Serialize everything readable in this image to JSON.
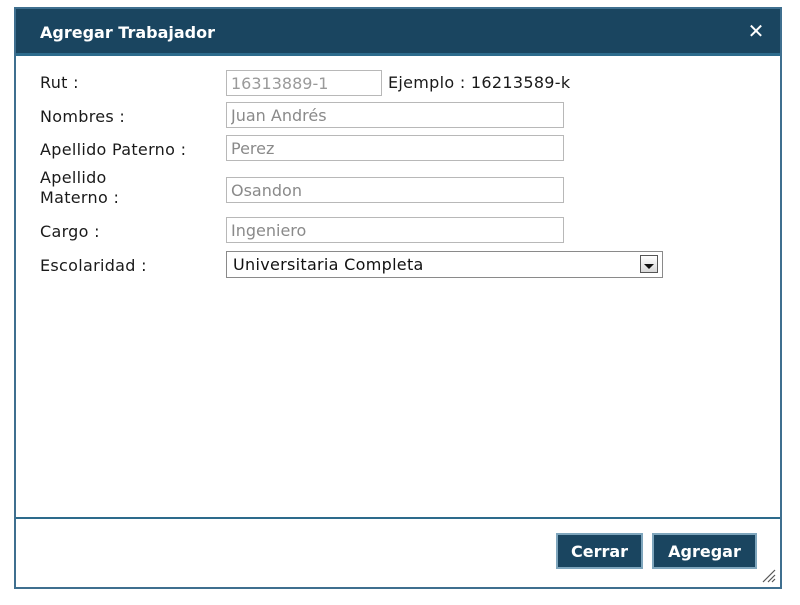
{
  "dialog": {
    "title": "Agregar Trabajador",
    "close_icon": "close-icon"
  },
  "form": {
    "rut": {
      "label": "Rut :",
      "value": "16313889-1",
      "example": "Ejemplo : 16213589-k"
    },
    "nombres": {
      "label": "Nombres :",
      "value": "Juan Andrés"
    },
    "apellido_paterno": {
      "label": "Apellido Paterno :",
      "value": "Perez"
    },
    "apellido_materno": {
      "label_line1": "Apellido",
      "label_line2": "Materno :",
      "value": "Osandon"
    },
    "cargo": {
      "label": "Cargo :",
      "value": "Ingeniero"
    },
    "escolaridad": {
      "label": "Escolaridad :",
      "selected": "Universitaria Completa"
    }
  },
  "footer": {
    "cerrar_label": "Cerrar",
    "agregar_label": "Agregar"
  },
  "colors": {
    "titlebar": "#1a4560",
    "button": "#1a4560",
    "border": "#3f6f8f"
  }
}
